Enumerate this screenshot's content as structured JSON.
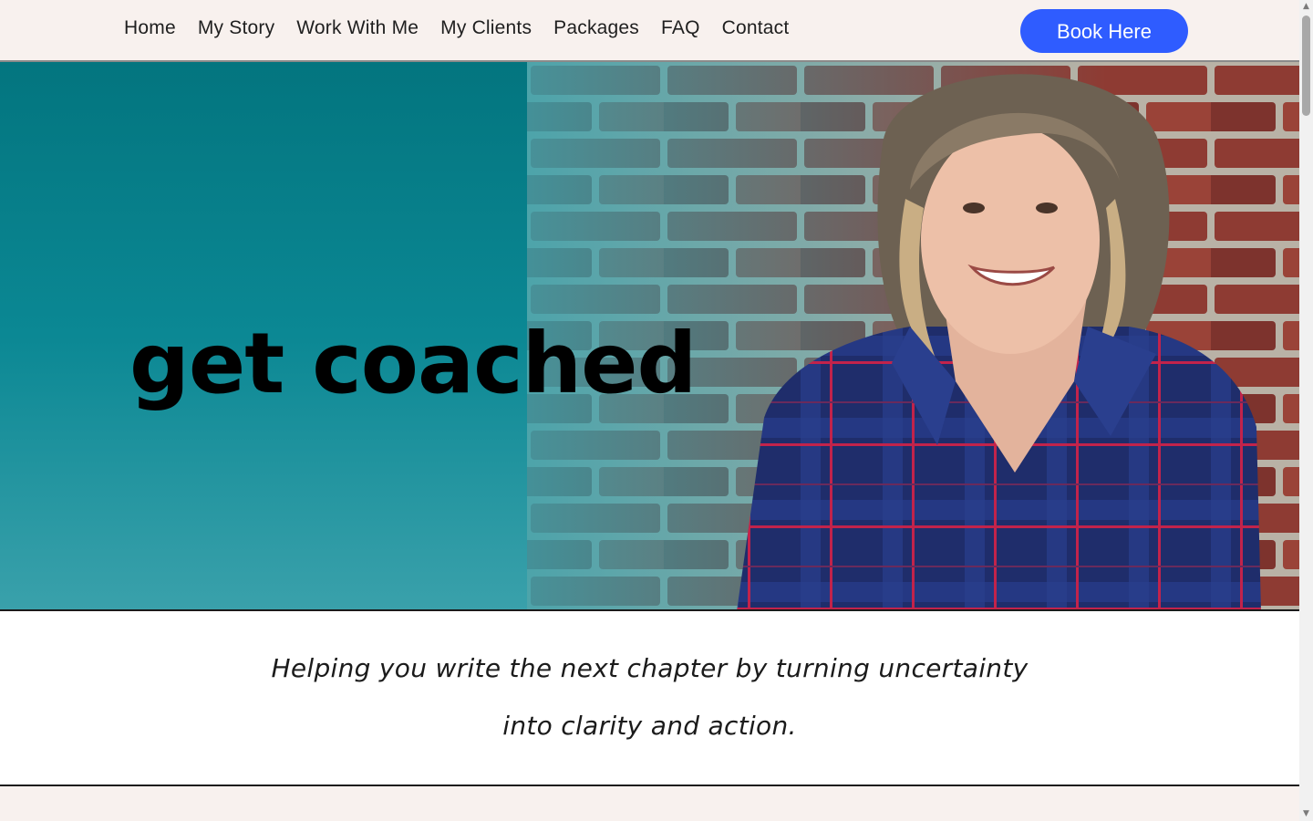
{
  "nav": {
    "items": [
      {
        "label": "Home"
      },
      {
        "label": "My Story"
      },
      {
        "label": "Work With Me"
      },
      {
        "label": "My Clients"
      },
      {
        "label": "Packages"
      },
      {
        "label": "FAQ"
      },
      {
        "label": "Contact"
      }
    ],
    "cta_label": "Book Here"
  },
  "hero": {
    "title": "get coached"
  },
  "tagline": {
    "line1": "Helping you write the next chapter by turning uncertainty",
    "line2": "into clarity and action."
  },
  "colors": {
    "brand_teal": "#0b8894",
    "cta_blue": "#2f5cff",
    "header_bg": "#f8f1ee"
  }
}
